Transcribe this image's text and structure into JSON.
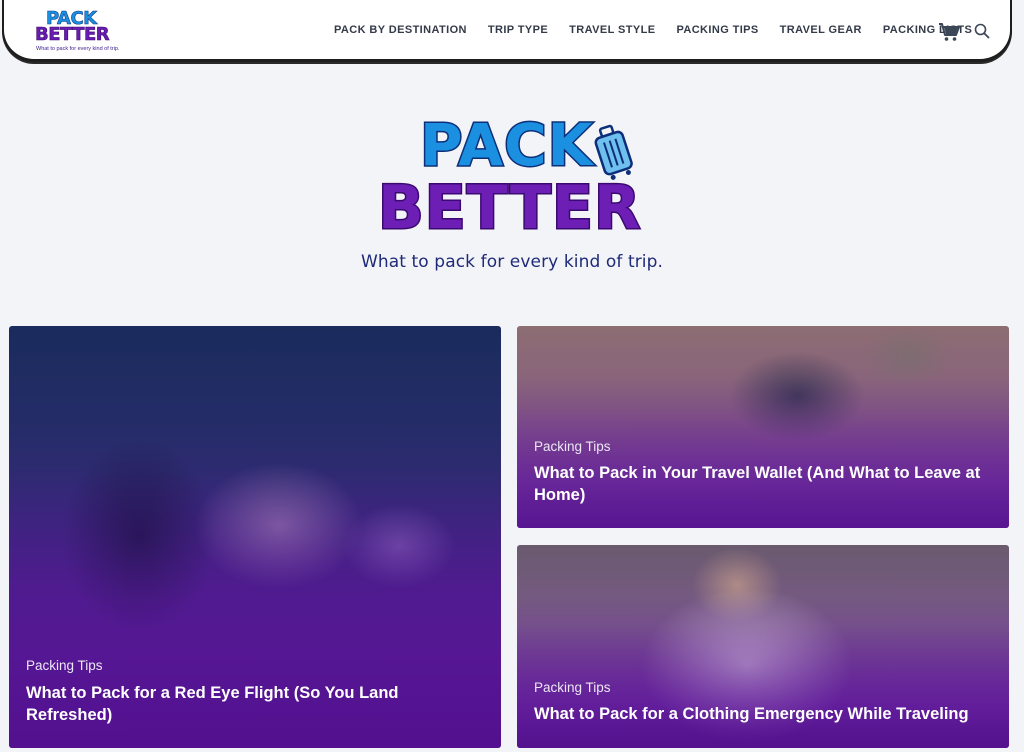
{
  "brand": {
    "small_logo_line1": "PACK",
    "small_logo_line2": "BETTER",
    "small_tagline": "What to pack for every kind of trip.",
    "hero_line1": "PACK",
    "hero_line2": "BETTER",
    "hero_tagline": "What to pack for every kind of trip.",
    "colors": {
      "blue": "#1b8fe0",
      "purple": "#6d1fb5",
      "navy": "#1f2a78"
    }
  },
  "nav": {
    "items": [
      "PACK BY DESTINATION",
      "TRIP TYPE",
      "TRAVEL STYLE",
      "PACKING TIPS",
      "TRAVEL GEAR",
      "PACKING LISTS"
    ],
    "icons": [
      "cart-icon",
      "search-icon"
    ]
  },
  "posts": [
    {
      "category": "Packing Tips",
      "title": "What to Pack for a Red Eye Flight (So You Land Refreshed)"
    },
    {
      "category": "Packing Tips",
      "title": "What to Pack in Your Travel Wallet (And What to Leave at Home)"
    },
    {
      "category": "Packing Tips",
      "title": "What to Pack for a Clothing Emergency While Traveling"
    }
  ]
}
